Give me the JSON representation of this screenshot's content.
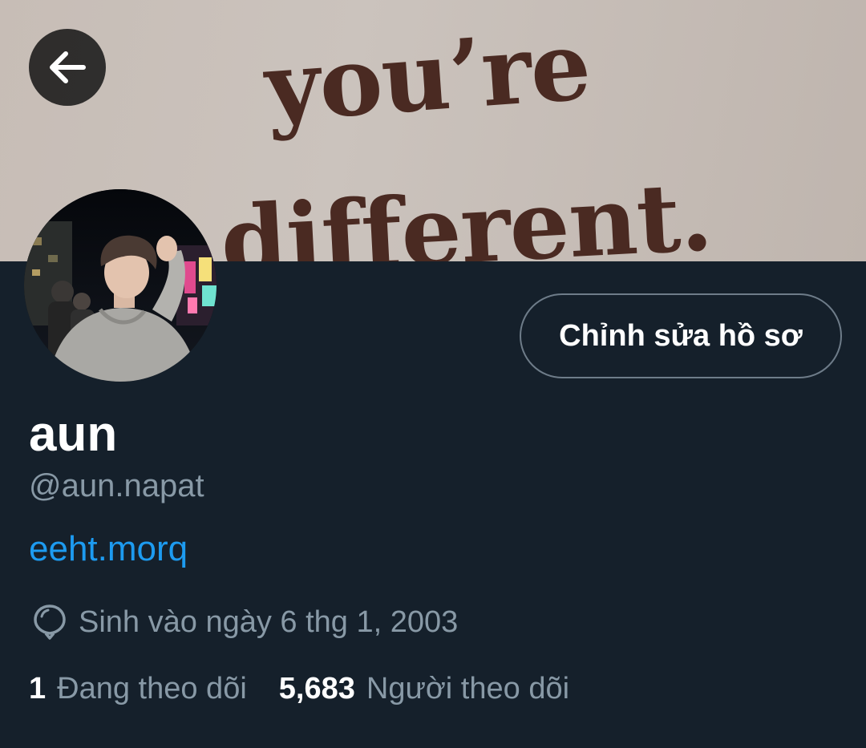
{
  "banner": {
    "line1": "you’re",
    "line2": "different."
  },
  "profile": {
    "display_name": "aun",
    "handle": "@aun.napat",
    "bio_link": "eeht.morq",
    "birthday": "Sinh vào ngày 6 thg 1, 2003"
  },
  "actions": {
    "edit_profile_label": "Chỉnh sửa hồ sơ"
  },
  "stats": {
    "following_count": "1",
    "following_label": "Đang theo dõi",
    "followers_count": "5,683",
    "followers_label": "Người theo dõi"
  },
  "icons": {
    "back": "arrow-left-icon",
    "birthday": "balloon-icon"
  },
  "colors": {
    "background": "#15202b",
    "accent_link": "#1d9bf0",
    "secondary_text": "#8899a6",
    "button_border": "#6e7c89"
  }
}
